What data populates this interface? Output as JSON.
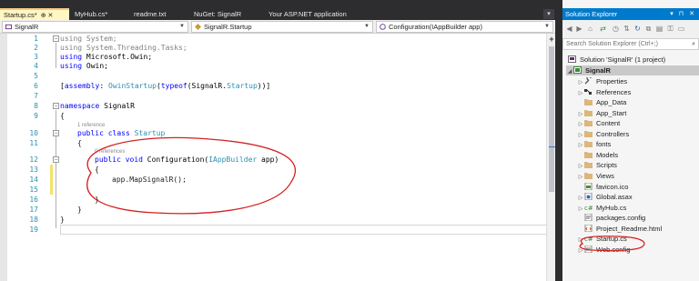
{
  "tabs": [
    {
      "label": "Startup.cs*",
      "active": true,
      "glyphs": "⊕ ✕"
    },
    {
      "label": "MyHub.cs*",
      "active": false
    },
    {
      "label": "readme.txt",
      "active": false
    },
    {
      "label": "NuGet: SignalR",
      "active": false
    },
    {
      "label": "Your ASP.NET application",
      "active": false
    }
  ],
  "navbar": {
    "project": "SignalR",
    "type": "SignalR.Startup",
    "member": "Configuration(IAppBuilder app)"
  },
  "code": {
    "line_numbers": [
      "1",
      "2",
      "3",
      "4",
      "5",
      "6",
      "7",
      "8",
      "9",
      "10",
      "11",
      "12",
      "13",
      "14",
      "15",
      "16",
      "17",
      "18",
      "19"
    ],
    "ref_class": "1 reference",
    "ref_method": "0 references",
    "lines": {
      "l1_kw": "using",
      "l1_rest": " System;",
      "l2_kw": "using",
      "l2_rest": " System.Threading.Tasks;",
      "l3_kw": "using",
      "l3_rest": " Microsoft.Owin;",
      "l4_kw": "using",
      "l4_rest": " Owin;",
      "l6_open": "[",
      "l6_kw": "assembly",
      "l6_colon": ": ",
      "l6_type": "OwinStartup",
      "l6_paren": "(",
      "l6_kw2": "typeof",
      "l6_arg": "(SignalR.",
      "l6_type2": "Startup",
      "l6_close": "))]",
      "l8_kw": "namespace",
      "l8_rest": " SignalR",
      "l9": "{",
      "l10_kw": "public class",
      "l10_type": " Startup",
      "l11": "{",
      "l12_kw": "public void",
      "l12_name": " Configuration(",
      "l12_type": "IAppBuilder",
      "l12_rest": " app)",
      "l13": "{",
      "l14": "app.MapSignalR();",
      "l16": "}",
      "l17": "}",
      "l18": "}"
    }
  },
  "solution_explorer": {
    "title": "Solution Explorer",
    "title_controls": "▾ ⊓ ✕",
    "search_placeholder": "Search Solution Explorer (Ctrl+;)",
    "solution": "Solution 'SignalR' (1 project)",
    "project": "SignalR",
    "items": [
      {
        "label": "Properties",
        "icon": "wrench-icon",
        "expandable": true
      },
      {
        "label": "References",
        "icon": "references-icon",
        "expandable": true
      },
      {
        "label": "App_Data",
        "icon": "folder-icon",
        "expandable": false
      },
      {
        "label": "App_Start",
        "icon": "folder-icon",
        "expandable": true
      },
      {
        "label": "Content",
        "icon": "folder-icon",
        "expandable": true
      },
      {
        "label": "Controllers",
        "icon": "folder-icon",
        "expandable": true
      },
      {
        "label": "fonts",
        "icon": "folder-icon",
        "expandable": true
      },
      {
        "label": "Models",
        "icon": "folder-icon",
        "expandable": false
      },
      {
        "label": "Scripts",
        "icon": "folder-icon",
        "expandable": true
      },
      {
        "label": "Views",
        "icon": "folder-icon",
        "expandable": true
      },
      {
        "label": "favicon.ico",
        "icon": "image-file-icon",
        "expandable": false
      },
      {
        "label": "Global.asax",
        "icon": "asax-file-icon",
        "expandable": true
      },
      {
        "label": "MyHub.cs",
        "icon": "csharp-file-icon",
        "expandable": true
      },
      {
        "label": "packages.config",
        "icon": "config-file-icon",
        "expandable": false
      },
      {
        "label": "Project_Readme.html",
        "icon": "html-file-icon",
        "expandable": false
      },
      {
        "label": "Startup.cs",
        "icon": "csharp-file-icon",
        "expandable": true
      },
      {
        "label": "Web.config",
        "icon": "config-file-icon",
        "expandable": true
      }
    ]
  },
  "colors": {
    "keyword": "#0000ff",
    "type": "#2b91af",
    "annotation": "#d42020",
    "accent": "#007acc"
  }
}
